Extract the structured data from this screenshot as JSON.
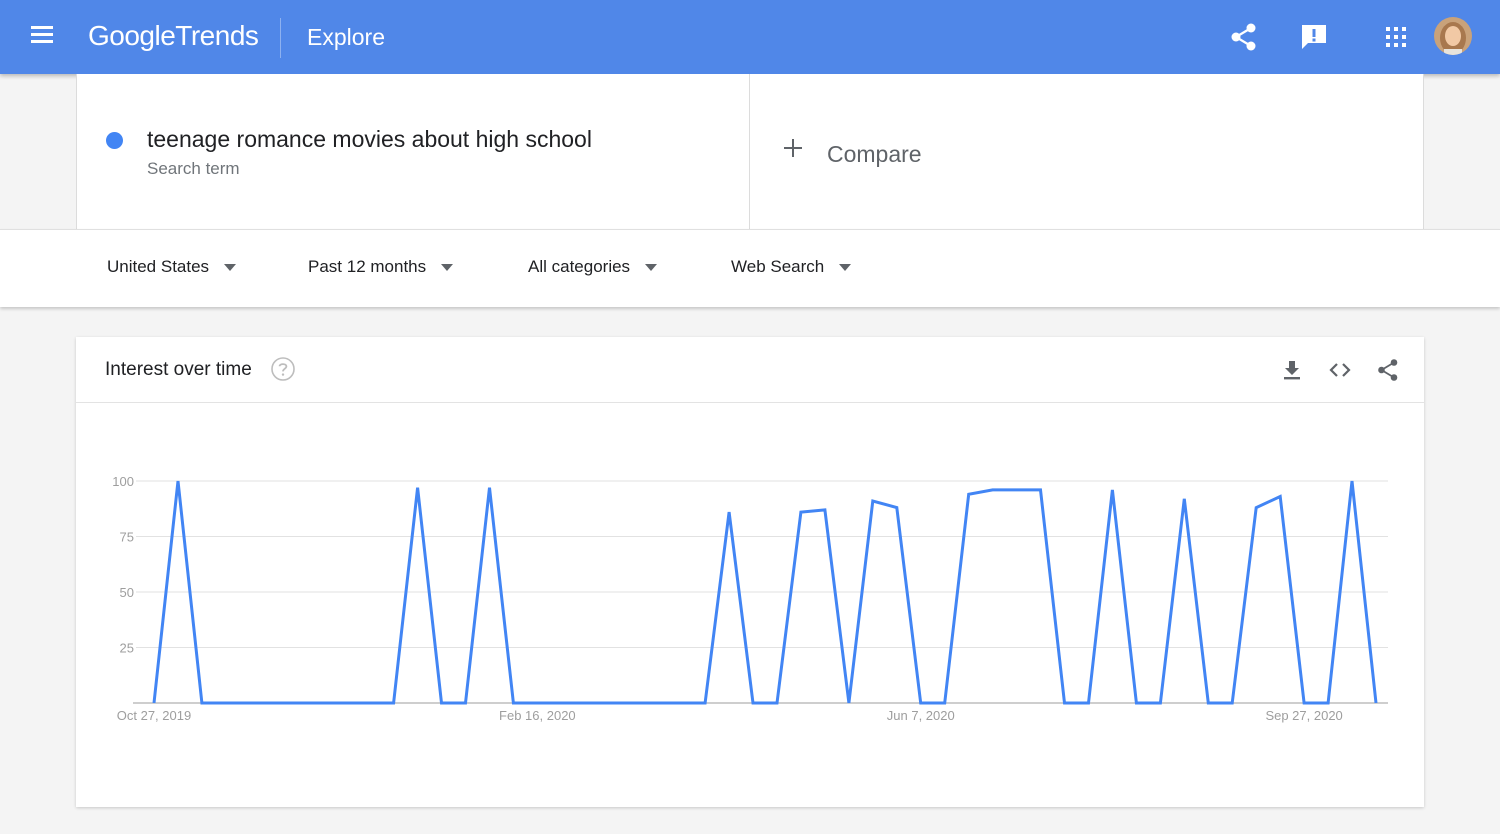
{
  "header": {
    "logo_google": "Google",
    "logo_trends": "Trends",
    "page_label": "Explore"
  },
  "search_term": {
    "text": "teenage romance movies about high school",
    "subtitle": "Search term",
    "color": "#4285f4"
  },
  "compare": {
    "label": "Compare"
  },
  "filters": [
    {
      "label": "United States"
    },
    {
      "label": "Past 12 months"
    },
    {
      "label": "All categories"
    },
    {
      "label": "Web Search"
    }
  ],
  "card": {
    "title": "Interest over time"
  },
  "colors": {
    "header": "#5087e8",
    "line": "#4285f4"
  },
  "chart_data": {
    "type": "line",
    "title": "Interest over time",
    "ylim": [
      0,
      100
    ],
    "yticks": [
      25,
      50,
      75,
      100
    ],
    "xtick_labels": [
      "Oct 27, 2019",
      "Feb 16, 2020",
      "Jun 7, 2020",
      "Sep 27, 2020"
    ],
    "grid": true,
    "series": [
      {
        "color": "#4285f4",
        "x": [
          "2019-10-27",
          "2019-11-03",
          "2019-11-10",
          "2019-11-17",
          "2019-11-24",
          "2019-12-01",
          "2019-12-08",
          "2019-12-15",
          "2019-12-22",
          "2019-12-29",
          "2020-01-05",
          "2020-01-12",
          "2020-01-19",
          "2020-01-26",
          "2020-02-02",
          "2020-02-09",
          "2020-02-16",
          "2020-02-23",
          "2020-03-01",
          "2020-03-08",
          "2020-03-15",
          "2020-03-22",
          "2020-03-29",
          "2020-04-05",
          "2020-04-12",
          "2020-04-19",
          "2020-04-26",
          "2020-05-03",
          "2020-05-10",
          "2020-05-17",
          "2020-05-24",
          "2020-05-31",
          "2020-06-07",
          "2020-06-14",
          "2020-06-21",
          "2020-06-28",
          "2020-07-05",
          "2020-07-12",
          "2020-07-19",
          "2020-07-26",
          "2020-08-02",
          "2020-08-09",
          "2020-08-16",
          "2020-08-23",
          "2020-08-30",
          "2020-09-06",
          "2020-09-13",
          "2020-09-20",
          "2020-09-27",
          "2020-10-04",
          "2020-10-11",
          "2020-10-18"
        ],
        "values": [
          0,
          100,
          0,
          0,
          0,
          0,
          0,
          0,
          0,
          0,
          0,
          97,
          0,
          0,
          97,
          0,
          0,
          0,
          0,
          0,
          0,
          0,
          0,
          0,
          86,
          0,
          0,
          86,
          87,
          0,
          91,
          88,
          0,
          0,
          94,
          96,
          96,
          96,
          0,
          0,
          96,
          0,
          0,
          92,
          0,
          0,
          88,
          93,
          0,
          0,
          100,
          0
        ]
      }
    ]
  }
}
